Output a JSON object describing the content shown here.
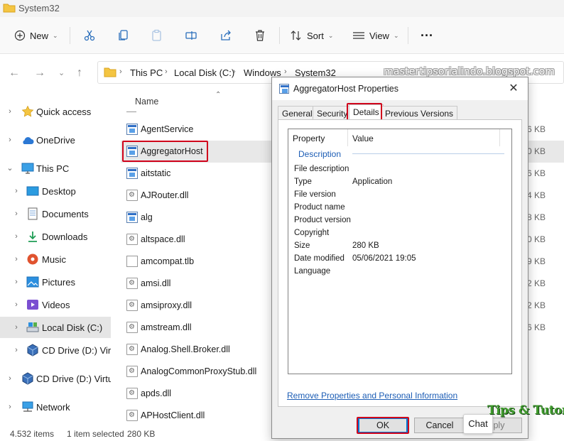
{
  "window": {
    "title": "System32"
  },
  "toolbar": {
    "new_label": "New",
    "sort_label": "Sort",
    "view_label": "View",
    "more_label": "···"
  },
  "address": {
    "crumbs": [
      "This PC",
      "Local Disk (C:)",
      "Windows",
      "System32"
    ]
  },
  "watermark": "mastertipsorialindo.blogspot.com",
  "sidebar": {
    "items": [
      {
        "label": "Quick access",
        "icon": "star-icon"
      },
      {
        "label": "OneDrive",
        "icon": "cloud-icon"
      },
      {
        "label": "This PC",
        "icon": "monitor-icon"
      },
      {
        "label": "Desktop",
        "icon": "desktop-icon"
      },
      {
        "label": "Documents",
        "icon": "documents-icon"
      },
      {
        "label": "Downloads",
        "icon": "download-icon"
      },
      {
        "label": "Music",
        "icon": "music-icon"
      },
      {
        "label": "Pictures",
        "icon": "pictures-icon"
      },
      {
        "label": "Videos",
        "icon": "videos-icon"
      },
      {
        "label": "Local Disk (C:)",
        "icon": "drive-icon"
      },
      {
        "label": "CD Drive (D:) Virtu",
        "icon": "cd-drive-icon"
      },
      {
        "label": "CD Drive (D:) Virtual",
        "icon": "cd-drive-icon"
      },
      {
        "label": "Network",
        "icon": "network-icon"
      }
    ]
  },
  "filelist": {
    "column_name": "Name",
    "rows": [
      {
        "name": "AgentService",
        "size": "6 KB",
        "icon": "exe"
      },
      {
        "name": "AggregatorHost",
        "size": "0 KB",
        "icon": "exe"
      },
      {
        "name": "aitstatic",
        "size": "6 KB",
        "icon": "exe"
      },
      {
        "name": "AJRouter.dll",
        "size": "4 KB",
        "icon": "dll"
      },
      {
        "name": "alg",
        "size": "8 KB",
        "icon": "exe"
      },
      {
        "name": "altspace.dll",
        "size": "0 KB",
        "icon": "dll"
      },
      {
        "name": "amcompat.tlb",
        "size": "9 KB",
        "icon": "doc"
      },
      {
        "name": "amsi.dll",
        "size": "2 KB",
        "icon": "dll"
      },
      {
        "name": "amsiproxy.dll",
        "size": "2 KB",
        "icon": "dll"
      },
      {
        "name": "amstream.dll",
        "size": "6 KB",
        "icon": "dll"
      },
      {
        "name": "Analog.Shell.Broker.dll",
        "size": "",
        "icon": "dll"
      },
      {
        "name": "AnalogCommonProxyStub.dll",
        "size": "",
        "icon": "dll"
      },
      {
        "name": "apds.dll",
        "size": "",
        "icon": "dll"
      },
      {
        "name": "APHostClient.dll",
        "size": "",
        "icon": "dll"
      }
    ]
  },
  "status": {
    "count": "4.532 items",
    "selected": "1 item selected",
    "size": "280 KB"
  },
  "dialog": {
    "title": "AggregatorHost Properties",
    "close": "✕",
    "tabs": [
      "General",
      "Security",
      "Details",
      "Previous Versions"
    ],
    "header_property": "Property",
    "header_value": "Value",
    "section": "Description",
    "props": [
      {
        "k": "File description",
        "v": ""
      },
      {
        "k": "Type",
        "v": "Application"
      },
      {
        "k": "File version",
        "v": ""
      },
      {
        "k": "Product name",
        "v": ""
      },
      {
        "k": "Product version",
        "v": ""
      },
      {
        "k": "Copyright",
        "v": ""
      },
      {
        "k": "Size",
        "v": "280 KB"
      },
      {
        "k": "Date modified",
        "v": "05/06/2021 19:05"
      },
      {
        "k": "Language",
        "v": ""
      }
    ],
    "remove_link": "Remove Properties and Personal Information",
    "ok": "OK",
    "cancel": "Cancel",
    "apply": "pply"
  },
  "chat_label": "Chat",
  "brand_text": "Tips & Tutorial"
}
